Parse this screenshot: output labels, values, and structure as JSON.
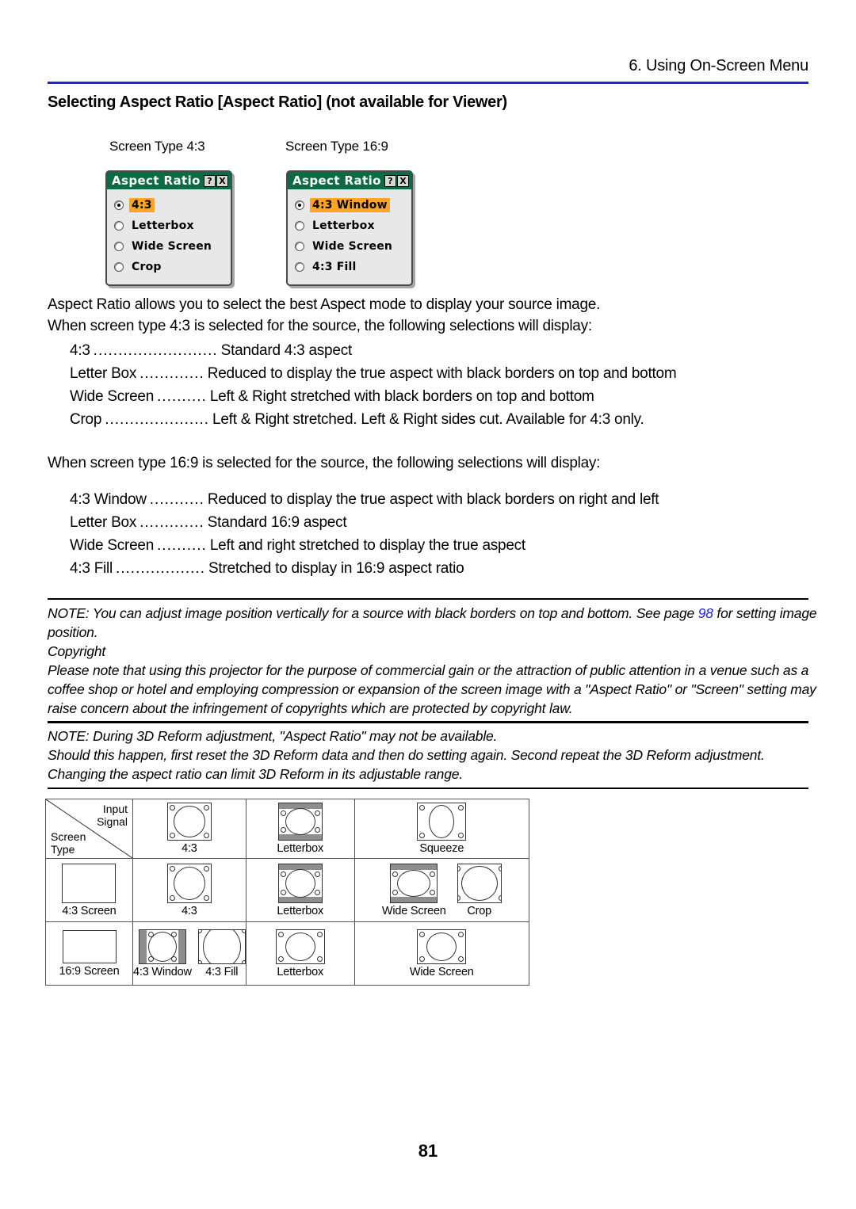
{
  "header": {
    "chapter": "6. Using On-Screen Menu",
    "rule_color": "#2222dd"
  },
  "section": {
    "title": "Selecting Aspect Ratio [Aspect Ratio] (not available for Viewer)"
  },
  "screen_type_captions": {
    "left": "Screen Type 4:3",
    "right": "Screen Type 16:9"
  },
  "osd_dialogs": [
    {
      "title": "Aspect Ratio",
      "help_button": "?",
      "close_button": "X",
      "titlebar_color": "#0a6b44",
      "highlight_color": "#ffa521",
      "items": [
        {
          "label": "4:3",
          "selected": true
        },
        {
          "label": "Letterbox",
          "selected": false
        },
        {
          "label": "Wide Screen",
          "selected": false
        },
        {
          "label": "Crop",
          "selected": false
        }
      ]
    },
    {
      "title": "Aspect Ratio",
      "help_button": "?",
      "close_button": "X",
      "titlebar_color": "#0a6b44",
      "highlight_color": "#ffa521",
      "items": [
        {
          "label": "4:3 Window",
          "selected": true
        },
        {
          "label": "Letterbox",
          "selected": false
        },
        {
          "label": "Wide Screen",
          "selected": false
        },
        {
          "label": "4:3 Fill",
          "selected": false
        }
      ]
    }
  ],
  "body": {
    "para_1": "Aspect Ratio allows you to select the best Aspect mode to display your source image.",
    "para_2": "When screen type 4:3 is selected for the source, the following selections will display:",
    "para_3": "When screen type 16:9 is selected for the source, the following selections will display:"
  },
  "definitions_43": [
    {
      "term": "4:3",
      "dots": ".........................",
      "desc": "Standard 4:3 aspect"
    },
    {
      "term": "Letter Box",
      "dots": ".............",
      "desc": "Reduced to display the true aspect with black borders on top and bottom"
    },
    {
      "term": "Wide Screen",
      "dots": "..........",
      "desc": "Left & Right stretched with black borders on top and bottom"
    },
    {
      "term": "Crop",
      "dots": ".....................",
      "desc": "Left & Right stretched. Left & Right sides cut. Available for 4:3 only."
    }
  ],
  "definitions_169": [
    {
      "term": "4:3 Window",
      "dots": "...........",
      "desc": "Reduced to display the true aspect with black borders on right and left"
    },
    {
      "term": "Letter Box",
      "dots": ".............",
      "desc": "Standard 16:9 aspect"
    },
    {
      "term": "Wide Screen",
      "dots": "..........",
      "desc": "Left and right stretched to display the true aspect"
    },
    {
      "term": "4:3 Fill",
      "dots": "..................",
      "desc": "Stretched to display in 16:9 aspect ratio"
    }
  ],
  "note_copyright": {
    "line_1_pre": "NOTE: You can adjust image position vertically for a source with black borders on top and bottom. See page ",
    "line_1_link": "98",
    "line_1_post": " for setting image",
    "line_2": "position.",
    "line_3": "Copyright",
    "line_4": "Please note that using this projector for the purpose of commercial gain or the attraction of public attention in a venue such as a",
    "line_5": "coffee shop or hotel and employing compression or expansion of the screen image with a \"Aspect Ratio\" or \"Screen\" setting may",
    "line_6": "raise concern about the infringement of copyrights which are protected by copyright law."
  },
  "note_3dreform": {
    "line_1": "NOTE: During 3D Reform adjustment, \"Aspect Ratio\" may not be available.",
    "line_2": "Should this happen, first reset the 3D Reform data and then do setting again. Second repeat the 3D Reform adjustment.",
    "line_3": "Changing the aspect ratio can limit 3D Reform in its adjustable range."
  },
  "diagram_table": {
    "corner": {
      "input_signal": "Input\nSignal",
      "input_line_1": "Input",
      "input_line_2": "Signal",
      "screen_line_1": "Screen",
      "screen_line_2": "Type"
    },
    "row_header": {
      "cell_a": "4:3",
      "cell_b": "Letterbox",
      "cell_c": "Squeeze"
    },
    "row_43": {
      "type_label": "4:3 Screen",
      "cell_a": "4:3",
      "cell_b": "Letterbox",
      "cell_c_1": "Wide Screen",
      "cell_c_2": "Crop"
    },
    "row_169": {
      "type_label": "16:9 Screen",
      "cell_a_1": "4:3 Window",
      "cell_a_2": "4:3 Fill",
      "cell_b": "Letterbox",
      "cell_c": "Wide Screen"
    },
    "band_color": "#8e8e8e"
  },
  "footer": {
    "page_number": "81"
  }
}
